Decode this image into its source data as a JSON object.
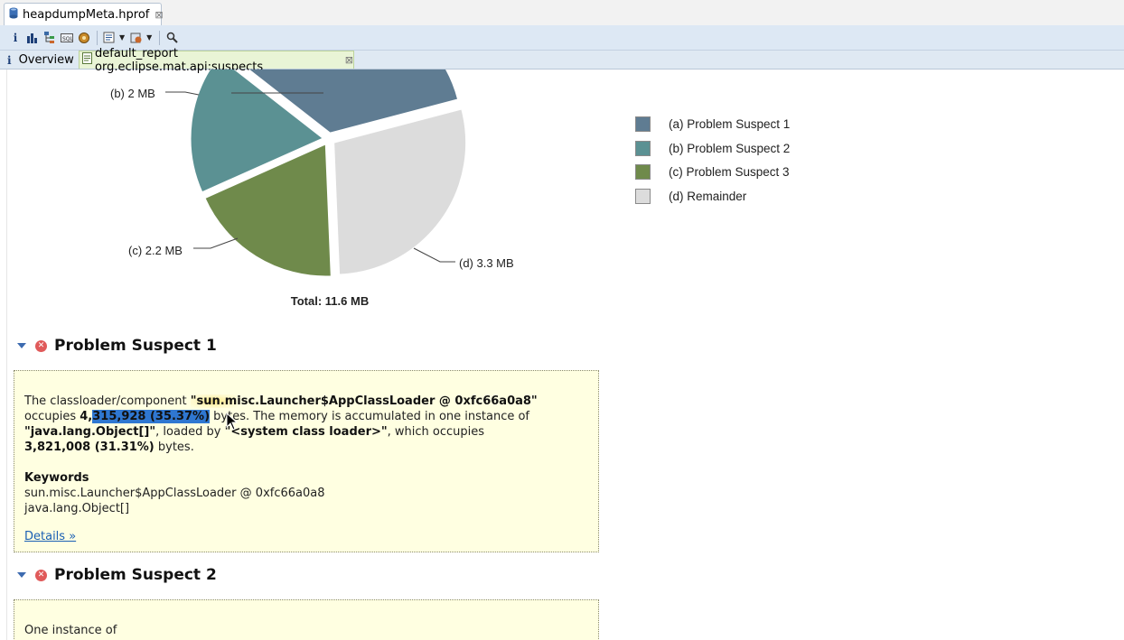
{
  "editor_tab": {
    "label": "heapdumpMeta.hprof",
    "close": "⊠"
  },
  "toolbar": {
    "buttons": [
      "info-icon",
      "histogram-icon",
      "dominator-tree-icon",
      "oql-icon",
      "thread-overview-icon",
      "run-report-icon",
      "query-browser-icon",
      "search-icon"
    ]
  },
  "inner_tabs": {
    "overview": "Overview",
    "report": "default_report  org.eclipse.mat.api:suspects",
    "close": "⊠"
  },
  "pie": {
    "total": "Total: 11.6 MB",
    "labels": {
      "a": "",
      "b": "(b)  2 MB",
      "c": "(c)  2.2 MB",
      "d": "(d)  3.3 MB"
    }
  },
  "chart_data": {
    "type": "pie",
    "title": "",
    "categories": [
      "(a) Problem Suspect 1",
      "(b) Problem Suspect 2",
      "(c) Problem Suspect 3",
      "(d) Remainder"
    ],
    "values": [
      4.1,
      2.0,
      2.2,
      3.3
    ],
    "colors": [
      "#5f7c92",
      "#5b9193",
      "#6f8a4b",
      "#dcdcdc"
    ],
    "units": "MB",
    "total": 11.6,
    "legend_position": "right"
  },
  "legend": [
    {
      "label": "(a)  Problem Suspect 1",
      "color": "#5f7c92"
    },
    {
      "label": "(b)  Problem Suspect 2",
      "color": "#5b9193"
    },
    {
      "label": "(c)  Problem Suspect 3",
      "color": "#6f8a4b"
    },
    {
      "label": "(d)  Remainder",
      "color": "#dcdcdc"
    }
  ],
  "suspect1": {
    "title": "Problem Suspect 1",
    "t1": "The classloader/component ",
    "b1a": "\"sun.m",
    "b1b": "isc.Launcher$AppClassLoader @ 0xfc66a0a8\"",
    "t2": "occupies ",
    "b2a": "4,",
    "hl": "315,928 (35.37%)",
    "t3": " bytes. The memory is accumulated in one instance of",
    "b3": "\"java.lang.Object[]\"",
    "t4": ", loaded by ",
    "b4": "\"<system class loader>\"",
    "t5": ", which occupies",
    "b5": "3,821,008 (31.31%)",
    "t6": " bytes.",
    "keywords_title": "Keywords",
    "keywords": [
      "sun.misc.Launcher$AppClassLoader @ 0xfc66a0a8",
      "java.lang.Object[]"
    ],
    "details": "Details »"
  },
  "suspect2": {
    "title": "Problem Suspect 2",
    "text": "One instance of"
  }
}
